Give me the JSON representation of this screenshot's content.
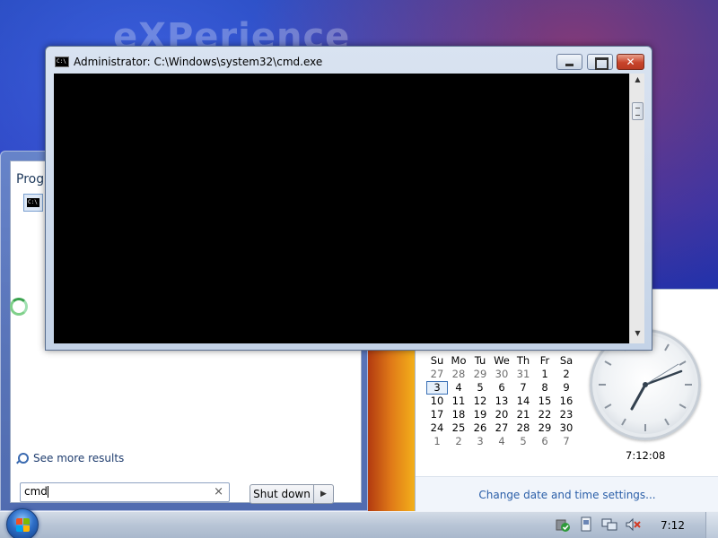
{
  "desktop": {
    "wallpaper_text": "eXPerience"
  },
  "cmd_window": {
    "title": "Administrator: C:\\Windows\\system32\\cmd.exe",
    "icon": "cmd-icon",
    "icon_text": "C:\\",
    "close_glyph": "✕"
  },
  "start_menu": {
    "programs_heading": "Programs",
    "program_icon_text": "C:\\",
    "see_more": "See more results",
    "search_value": "cmd",
    "clear_glyph": "×",
    "shutdown_label": "Shut down",
    "shutdown_arrow": "▶"
  },
  "clock": {
    "weekdays": [
      "Su",
      "Mo",
      "Tu",
      "We",
      "Th",
      "Fr",
      "Sa"
    ],
    "weeks": [
      [
        "27",
        "28",
        "29",
        "30",
        "31",
        "1",
        "2"
      ],
      [
        "3",
        "4",
        "5",
        "6",
        "7",
        "8",
        "9"
      ],
      [
        "10",
        "11",
        "12",
        "13",
        "14",
        "15",
        "16"
      ],
      [
        "17",
        "18",
        "19",
        "20",
        "21",
        "22",
        "23"
      ],
      [
        "24",
        "25",
        "26",
        "27",
        "28",
        "29",
        "30"
      ],
      [
        "1",
        "2",
        "3",
        "4",
        "5",
        "6",
        "7"
      ]
    ],
    "today": "3",
    "digital_time": "7:12:08",
    "change_settings": "Change date and time settings..."
  },
  "taskbar": {
    "clock": "7:12",
    "tray_icons": [
      "security-shield-icon",
      "device-icon",
      "network-icon",
      "volume-muted-icon"
    ]
  },
  "colors": {
    "console_bg": "#000000",
    "link": "#2a5ea8",
    "close_button": "#c8442b"
  }
}
